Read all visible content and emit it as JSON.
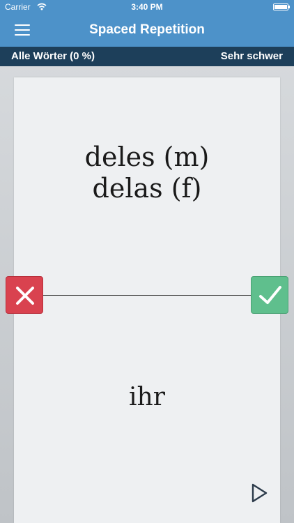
{
  "status_bar": {
    "carrier": "Carrier",
    "time": "3:40 PM"
  },
  "nav": {
    "title": "Spaced Repetition",
    "menu_icon": "hamburger-icon"
  },
  "subheader": {
    "left": "Alle Wörter (0 %)",
    "right": "Sehr schwer"
  },
  "card": {
    "front_lines": [
      "deles (m)",
      "delas (f)"
    ],
    "back": "ihr"
  },
  "buttons": {
    "wrong_icon": "close-icon",
    "right_icon": "checkmark-icon",
    "play_icon": "play-icon"
  },
  "colors": {
    "header": "#4d92c9",
    "subheader": "#1d3f5a",
    "wrong": "#d9424f",
    "right": "#5fbf8d"
  }
}
